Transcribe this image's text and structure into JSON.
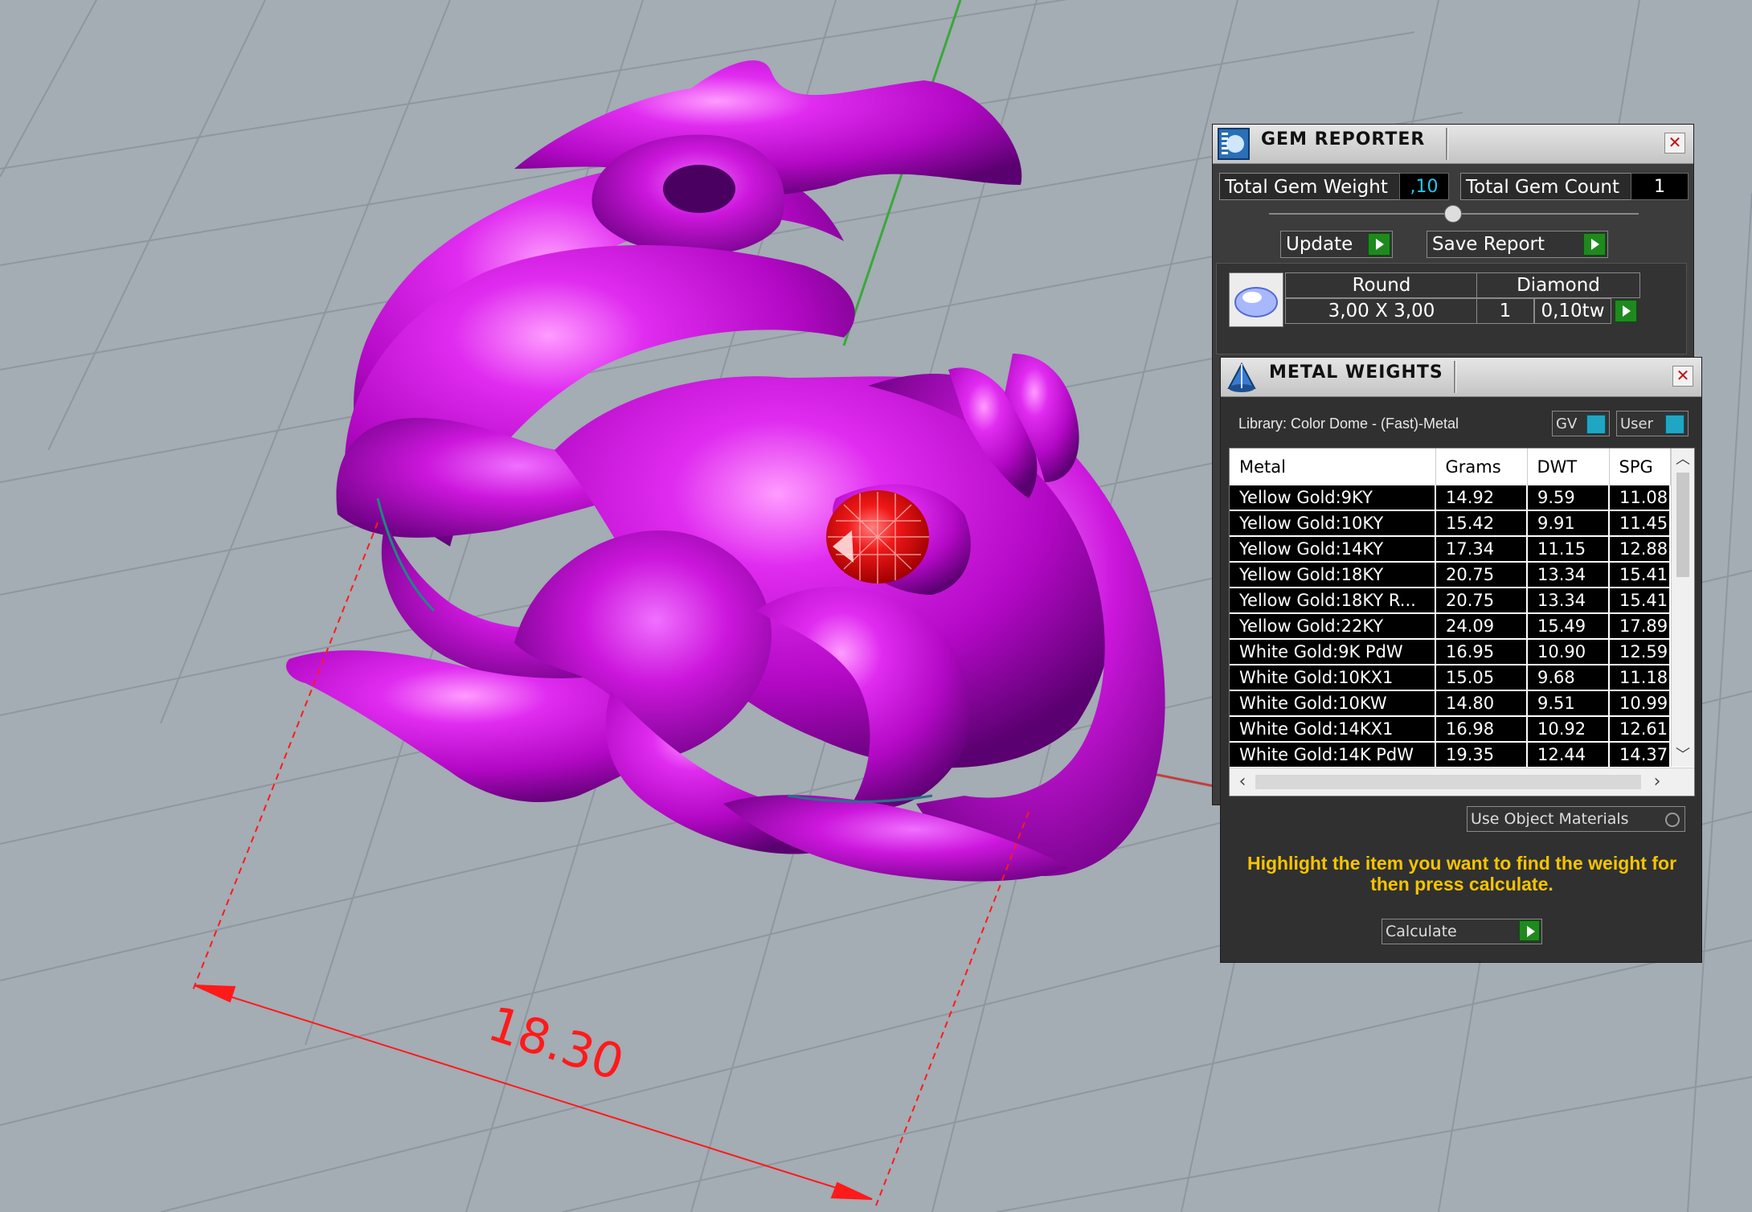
{
  "viewport": {
    "dimension_label": "18.30",
    "model_color": "#cc16dc",
    "gem_color": "#e81010",
    "grid_color": "#a4acb4"
  },
  "gem_reporter": {
    "title": "GEM REPORTER",
    "total_weight_label": "Total Gem Weight",
    "total_weight_value": ",10",
    "total_count_label": "Total Gem Count",
    "total_count_value": "1",
    "update_label": "Update",
    "save_report_label": "Save Report",
    "gem": {
      "shape": "Round",
      "type": "Diamond",
      "size": "3,00 X 3,00",
      "qty": "1",
      "weight": "0,10tw"
    }
  },
  "metal_weights": {
    "title": "METAL WEIGHTS",
    "library_label": "Library: Color Dome - (Fast)-Metal",
    "gv_label": "GV",
    "user_label": "User",
    "columns": [
      "Metal",
      "Grams",
      "DWT",
      "SPG"
    ],
    "rows": [
      [
        "Yellow Gold:9KY",
        "14.92",
        "9.59",
        "11.08"
      ],
      [
        "Yellow Gold:10KY",
        "15.42",
        "9.91",
        "11.45"
      ],
      [
        "Yellow Gold:14KY",
        "17.34",
        "11.15",
        "12.88"
      ],
      [
        "Yellow Gold:18KY",
        "20.75",
        "13.34",
        "15.41"
      ],
      [
        "Yellow Gold:18KY R...",
        "20.75",
        "13.34",
        "15.41"
      ],
      [
        "Yellow Gold:22KY",
        "24.09",
        "15.49",
        "17.89"
      ],
      [
        "White Gold:9K PdW",
        "16.95",
        "10.90",
        "12.59"
      ],
      [
        "White Gold:10KX1",
        "15.05",
        "9.68",
        "11.18"
      ],
      [
        "White Gold:10KW",
        "14.80",
        "9.51",
        "10.99"
      ],
      [
        "White Gold:14KX1",
        "16.98",
        "10.92",
        "12.61"
      ],
      [
        "White Gold:14K PdW",
        "19.35",
        "12.44",
        "14.37"
      ]
    ],
    "use_object_materials_label": "Use Object Materials",
    "hint": "Highlight the item you want to find the weight for then press calculate.",
    "calculate_label": "Calculate"
  }
}
